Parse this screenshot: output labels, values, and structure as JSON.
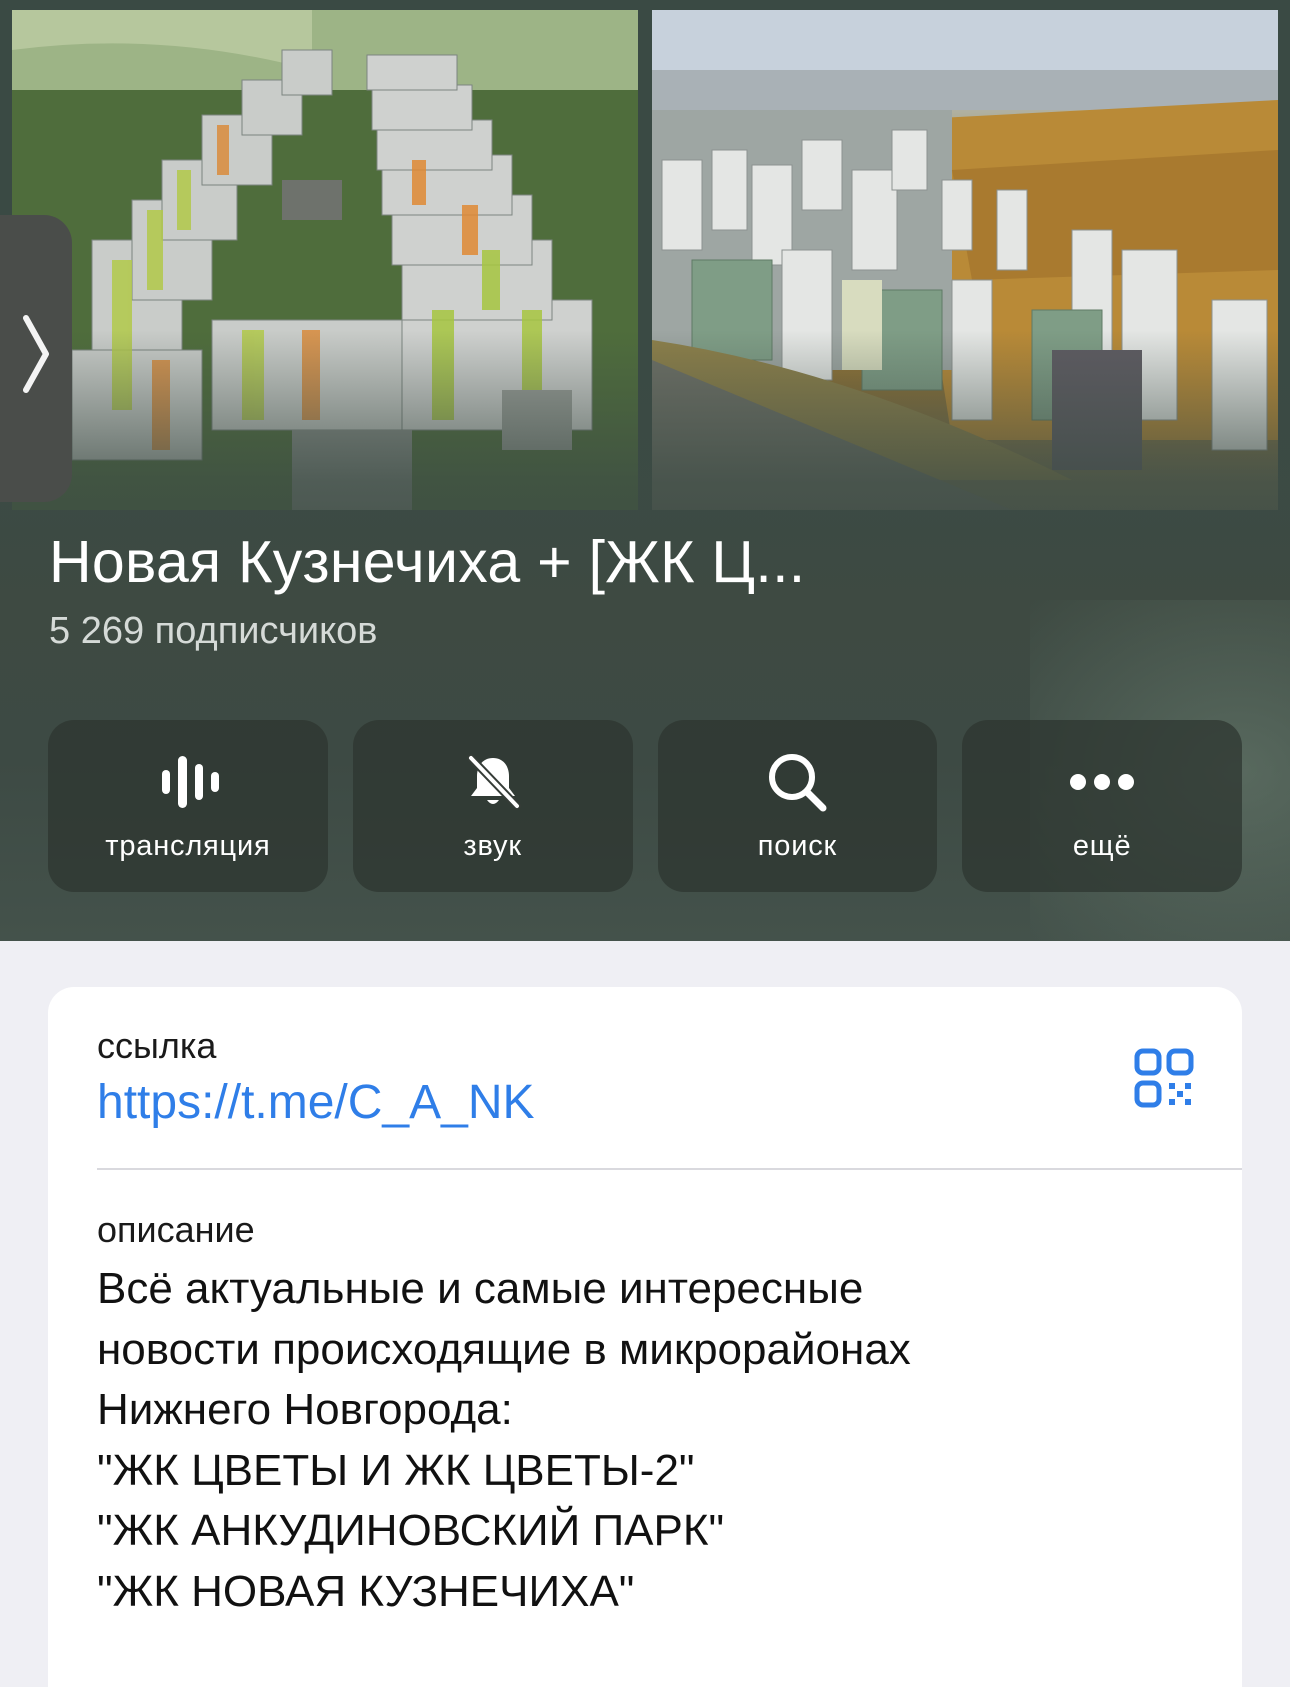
{
  "channel": {
    "title": "Новая Кузнечиха + [ЖК Ц...",
    "subscribers": "5 269 подписчиков"
  },
  "actions": [
    {
      "label": "трансляция",
      "icon": "live-stream-icon"
    },
    {
      "label": "звук",
      "icon": "bell-muted-icon"
    },
    {
      "label": "поиск",
      "icon": "search-icon"
    },
    {
      "label": "ещё",
      "icon": "more-dots-icon"
    }
  ],
  "info": {
    "link_label": "ссылка",
    "link_value": "https://t.me/C_A_NK",
    "description_label": "описание",
    "description_lines": [
      "Всё актуальные и самые интересные",
      "новости происходящие в микрорайонах",
      "Нижнего Новгорода:",
      "\"ЖК ЦВЕТЫ И ЖК ЦВЕТЫ-2\"",
      "\"ЖК АНКУДИНОВСКИЙ ПАРК\"",
      "\"ЖК НОВАЯ КУЗНЕЧИХА\""
    ]
  },
  "icons": {
    "side_tab": "chevron-right-icon",
    "qr": "qr-code-icon"
  },
  "colors": {
    "link": "#2f7ee8",
    "page_background": "#efeff4",
    "action_background": "#2d342f"
  }
}
